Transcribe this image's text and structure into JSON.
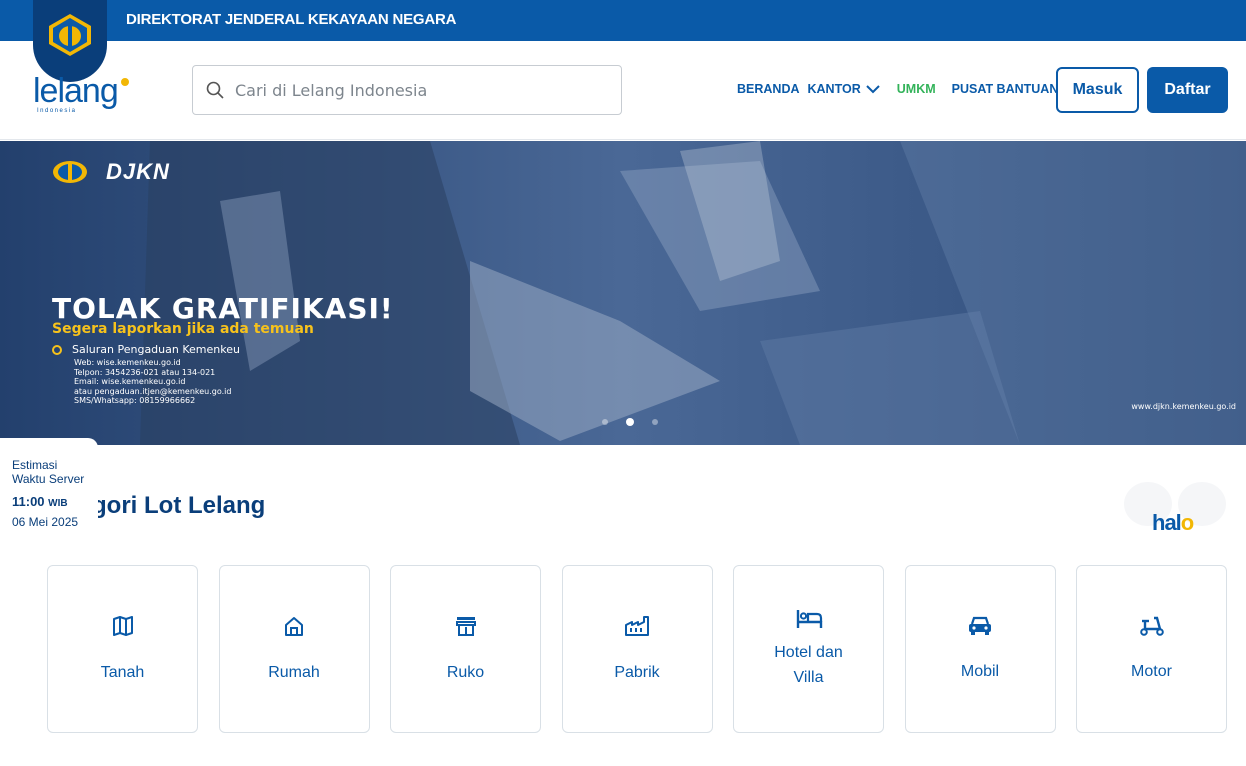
{
  "topbar": {
    "title": "DIREKTORAT JENDERAL KEKAYAAN NEGARA"
  },
  "logo": {
    "word": "lelang",
    "sub": "Indonesia"
  },
  "search": {
    "placeholder": "Cari di Lelang Indonesia"
  },
  "nav": {
    "beranda": "BERANDA",
    "kantor": "KANTOR",
    "umkm": "UMKM",
    "pusat_bantuan": "PUSAT BANTUAN",
    "masuk": "Masuk",
    "daftar": "Daftar"
  },
  "hero": {
    "brand": "DJKN",
    "title": "TOLAK GRATIFIKASI!",
    "subtitle": "Segera laporkan jika ada temuan",
    "channel": "Saluran Pengaduan Kemenkeu",
    "contacts": [
      "Web: wise.kemenkeu.go.id",
      "Telpon: 3454236-021 atau 134-021",
      "Email: wise.kemenkeu.go.id",
      "atau pengaduan.itjen@kemenkeu.go.id",
      "SMS/Whatsapp: 08159966662"
    ],
    "url": "www.djkn.kemenkeu.go.id",
    "slides": 3,
    "active_slide": 2
  },
  "server_time": {
    "label_line1": "Estimasi",
    "label_line2": "Waktu Server",
    "time": "11:00",
    "zone": "WIB",
    "date": "06 Mei 2025"
  },
  "section": {
    "title": "Kategori Lot Lelang"
  },
  "halo": {
    "text_a": "hal",
    "text_b": "o"
  },
  "categories": [
    {
      "label": "Tanah",
      "icon": "map-icon"
    },
    {
      "label": "Rumah",
      "icon": "house-icon"
    },
    {
      "label": "Ruko",
      "icon": "store-icon"
    },
    {
      "label": "Pabrik",
      "icon": "factory-icon"
    },
    {
      "label": "Hotel dan Villa",
      "icon": "bed-icon"
    },
    {
      "label": "Mobil",
      "icon": "car-icon"
    },
    {
      "label": "Motor",
      "icon": "scooter-icon"
    }
  ],
  "colors": {
    "primary": "#0a5aa8",
    "dark": "#0a3e7a",
    "umkm": "#33b35a",
    "accent": "#f2b705"
  }
}
